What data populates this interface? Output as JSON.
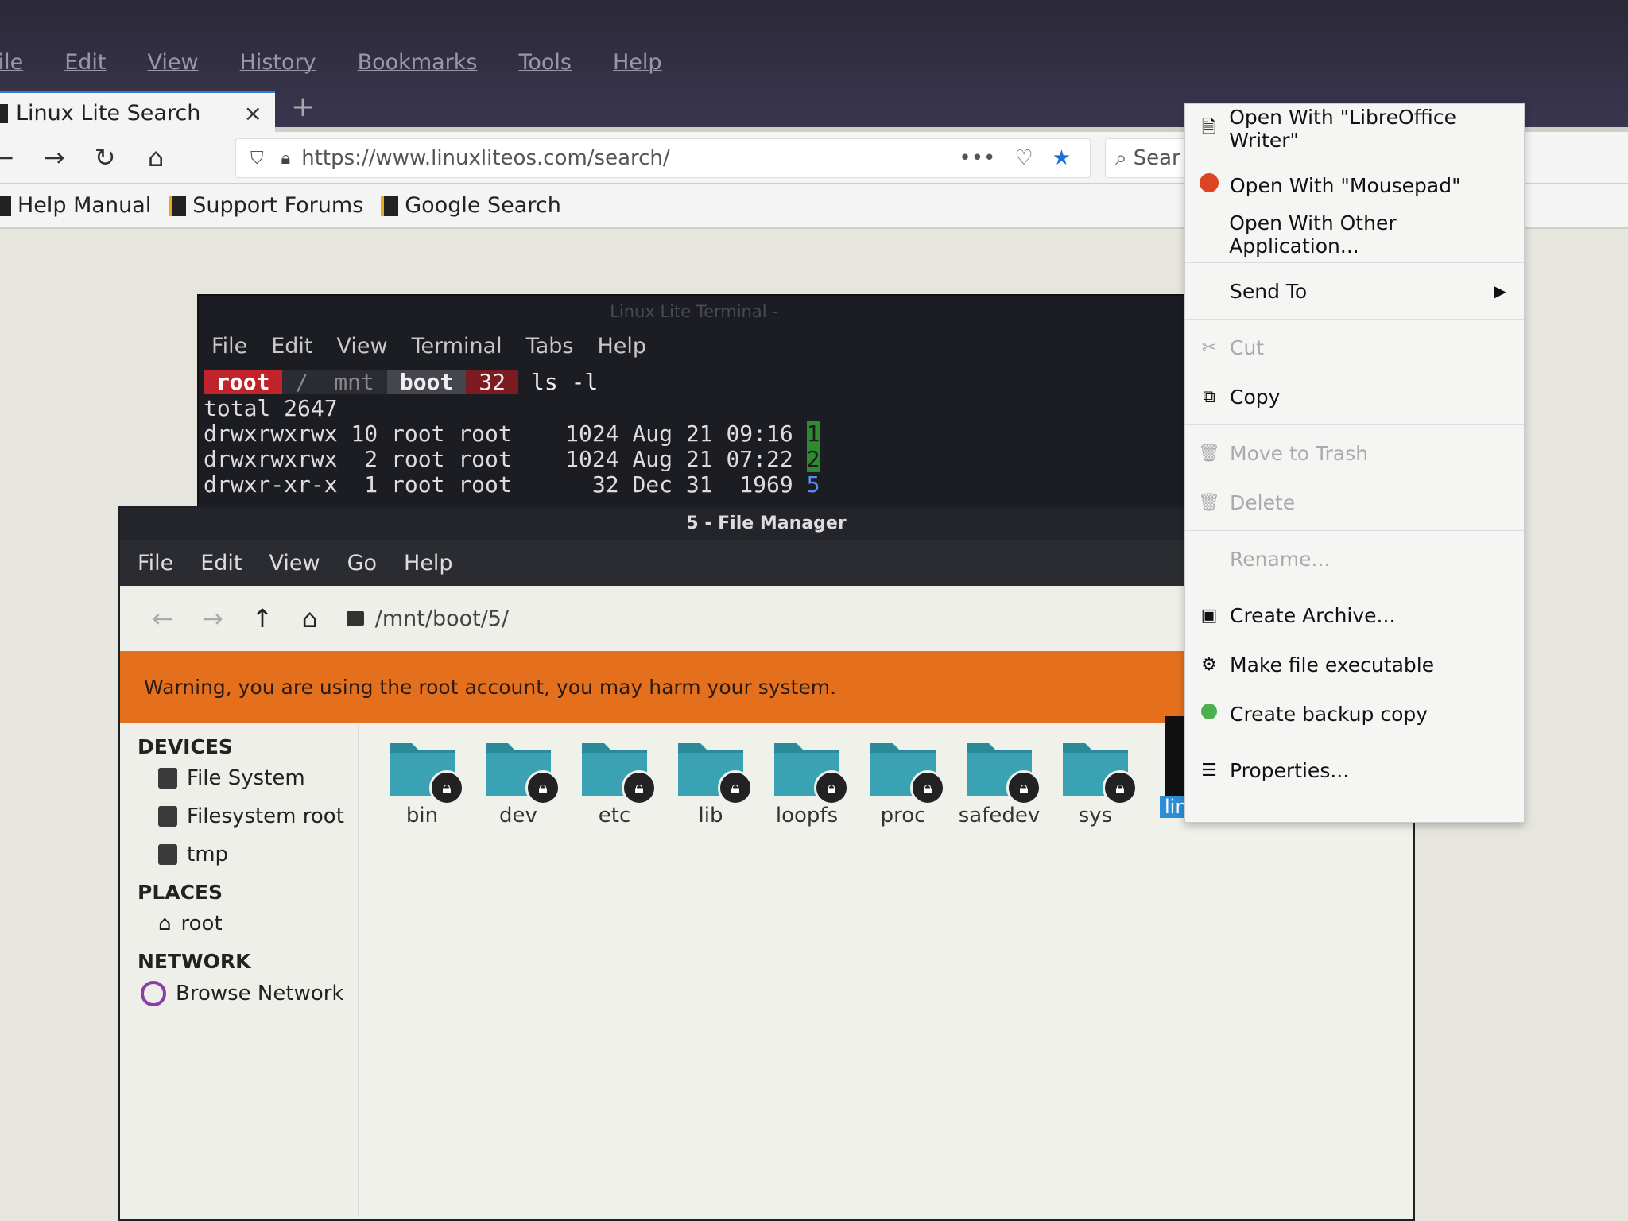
{
  "firefox": {
    "menu": [
      "File",
      "Edit",
      "View",
      "History",
      "Bookmarks",
      "Tools",
      "Help"
    ],
    "tab": {
      "title": "Linux Lite Search",
      "close": "×"
    },
    "new_tab": "+",
    "url": "https://www.linuxliteos.com/search/",
    "search_placeholder": "Sear",
    "bookmarks": [
      "Help Manual",
      "Support Forums",
      "Google Search"
    ]
  },
  "terminal": {
    "title": "Linux Lite Terminal -",
    "menu": [
      "File",
      "Edit",
      "View",
      "Terminal",
      "Tabs",
      "Help"
    ],
    "prompt": {
      "user": "root",
      "p1": "/",
      "p2": "mnt",
      "p3": "boot",
      "p4": "32",
      "cmd": "ls -l"
    },
    "lines": [
      {
        "text": "total 2647",
        "suffix": ""
      },
      {
        "text": "drwxrwxrwx 10 root root    1024 Aug 21 09:16 ",
        "suffix": "1"
      },
      {
        "text": "drwxrwxrwx  2 root root    1024 Aug 21 07:22 ",
        "suffix": "2"
      },
      {
        "text": "drwxr-xr-x  1 root root      32 Dec 31  1969 ",
        "suffix": "5"
      }
    ]
  },
  "file_manager": {
    "title": "5 - File Manager",
    "menu": [
      "File",
      "Edit",
      "View",
      "Go",
      "Help"
    ],
    "path": "/mnt/boot/5/",
    "warning": "Warning, you are using the root account, you may harm your system.",
    "sidebar": {
      "devices_heading": "DEVICES",
      "devices": [
        "File System",
        "Filesystem root",
        "tmp"
      ],
      "places_heading": "PLACES",
      "places": [
        "root"
      ],
      "network_heading": "NETWORK",
      "network": [
        "Browse Network"
      ]
    },
    "folders": [
      "bin",
      "dev",
      "etc",
      "lib",
      "loopfs",
      "proc",
      "safedev",
      "sys"
    ],
    "selected_file_label": "linu"
  },
  "context_menu": {
    "items": [
      "Open With \"LibreOffice Writer\"",
      "Open With \"Mousepad\"",
      "Open With Other Application...",
      "Send To",
      "Cut",
      "Copy",
      "Move to Trash",
      "Delete",
      "Rename...",
      "Create Archive...",
      "Make file executable",
      "Create backup copy",
      "Properties..."
    ]
  },
  "colors": {
    "warning_bar": "#e4701e",
    "folder": "#2a8a9a",
    "prompt_root": "#c0242a",
    "selection": "#2b8fd6"
  }
}
